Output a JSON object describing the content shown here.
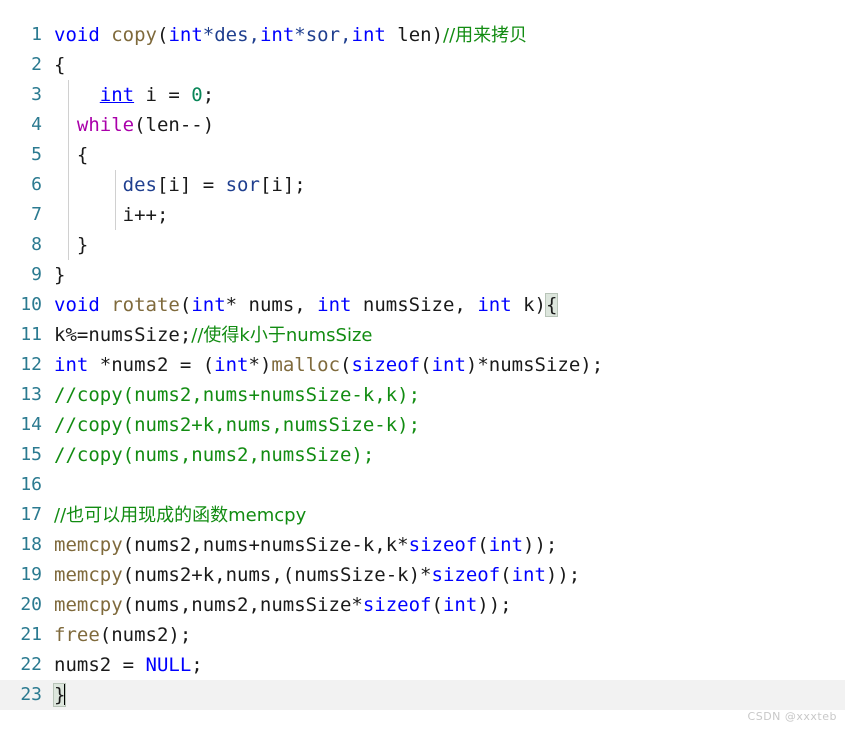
{
  "editor": {
    "language": "C",
    "total_lines": 23,
    "current_line": 23,
    "colors": {
      "background": "#ffffff",
      "line_number": "#2b7a90",
      "keyword": "#0000ff",
      "control_keyword": "#aa00aa",
      "function": "#7f6a3c",
      "parameter": "#1f3f8f",
      "number": "#098658",
      "comment": "#128c12",
      "plain_text": "#1a1a1a",
      "brace_highlight": "#dde6dd",
      "current_line_highlight": "#f2f2f2",
      "indent_guide": "#d0d0d0"
    }
  },
  "lines": [
    {
      "n": "1",
      "tokens": [
        {
          "t": "void",
          "c": "kw"
        },
        {
          "t": " ",
          "c": "plain"
        },
        {
          "t": "copy",
          "c": "fn"
        },
        {
          "t": "(",
          "c": "plain"
        },
        {
          "t": "int",
          "c": "kw"
        },
        {
          "t": "*des,",
          "c": "param"
        },
        {
          "t": "int",
          "c": "kw"
        },
        {
          "t": "*sor,",
          "c": "param"
        },
        {
          "t": "int",
          "c": "kw"
        },
        {
          "t": " len)",
          "c": "plain"
        },
        {
          "t": "//用来拷贝",
          "c": "cmt cjk"
        }
      ]
    },
    {
      "n": "2",
      "tokens": [
        {
          "t": "{",
          "c": "plain"
        }
      ]
    },
    {
      "n": "3",
      "tokens": [
        {
          "t": "    ",
          "c": "plain"
        },
        {
          "t": "int",
          "c": "kw-u"
        },
        {
          "t": " i = ",
          "c": "plain"
        },
        {
          "t": "0",
          "c": "num"
        },
        {
          "t": ";",
          "c": "plain"
        }
      ]
    },
    {
      "n": "4",
      "tokens": [
        {
          "t": "  ",
          "c": "plain"
        },
        {
          "t": "while",
          "c": "ctl"
        },
        {
          "t": "(len--)",
          "c": "plain"
        }
      ]
    },
    {
      "n": "5",
      "tokens": [
        {
          "t": "  {",
          "c": "plain"
        }
      ]
    },
    {
      "n": "6",
      "tokens": [
        {
          "t": "      ",
          "c": "plain"
        },
        {
          "t": "des",
          "c": "param"
        },
        {
          "t": "[i] = ",
          "c": "plain"
        },
        {
          "t": "sor",
          "c": "param"
        },
        {
          "t": "[i];",
          "c": "plain"
        }
      ]
    },
    {
      "n": "7",
      "tokens": [
        {
          "t": "      i++;",
          "c": "plain"
        }
      ]
    },
    {
      "n": "8",
      "tokens": [
        {
          "t": "  }",
          "c": "plain"
        }
      ]
    },
    {
      "n": "9",
      "tokens": [
        {
          "t": "}",
          "c": "plain"
        }
      ]
    },
    {
      "n": "10",
      "tokens": [
        {
          "t": "void",
          "c": "kw"
        },
        {
          "t": " ",
          "c": "plain"
        },
        {
          "t": "rotate",
          "c": "fn"
        },
        {
          "t": "(",
          "c": "plain"
        },
        {
          "t": "int",
          "c": "kw"
        },
        {
          "t": "* nums, ",
          "c": "plain"
        },
        {
          "t": "int",
          "c": "kw"
        },
        {
          "t": " numsSize, ",
          "c": "plain"
        },
        {
          "t": "int",
          "c": "kw"
        },
        {
          "t": " k)",
          "c": "plain"
        },
        {
          "t": "{",
          "c": "brace-hl"
        }
      ]
    },
    {
      "n": "11",
      "tokens": [
        {
          "t": "k%=numsSize;",
          "c": "plain"
        },
        {
          "t": "//使得k小于numsSize",
          "c": "cmt cjk"
        }
      ]
    },
    {
      "n": "12",
      "tokens": [
        {
          "t": "int",
          "c": "kw"
        },
        {
          "t": " *nums2 = (",
          "c": "plain"
        },
        {
          "t": "int",
          "c": "kw"
        },
        {
          "t": "*)",
          "c": "plain"
        },
        {
          "t": "malloc",
          "c": "fn"
        },
        {
          "t": "(",
          "c": "plain"
        },
        {
          "t": "sizeof",
          "c": "kw"
        },
        {
          "t": "(",
          "c": "plain"
        },
        {
          "t": "int",
          "c": "kw"
        },
        {
          "t": ")*numsSize);",
          "c": "plain"
        }
      ]
    },
    {
      "n": "13",
      "tokens": [
        {
          "t": "//copy(nums2,nums+numsSize-k,k);",
          "c": "cmt"
        }
      ]
    },
    {
      "n": "14",
      "tokens": [
        {
          "t": "//copy(nums2+k,nums,numsSize-k);",
          "c": "cmt"
        }
      ]
    },
    {
      "n": "15",
      "tokens": [
        {
          "t": "//copy(nums,nums2,numsSize);",
          "c": "cmt"
        }
      ]
    },
    {
      "n": "16",
      "tokens": [
        {
          "t": "",
          "c": "plain"
        }
      ]
    },
    {
      "n": "17",
      "tokens": [
        {
          "t": "//也可以用现成的函数memcpy",
          "c": "cmt cjk"
        }
      ]
    },
    {
      "n": "18",
      "tokens": [
        {
          "t": "memcpy",
          "c": "fn"
        },
        {
          "t": "(nums2,nums+numsSize-k,k*",
          "c": "plain"
        },
        {
          "t": "sizeof",
          "c": "kw"
        },
        {
          "t": "(",
          "c": "plain"
        },
        {
          "t": "int",
          "c": "kw"
        },
        {
          "t": "));",
          "c": "plain"
        }
      ]
    },
    {
      "n": "19",
      "tokens": [
        {
          "t": "memcpy",
          "c": "fn"
        },
        {
          "t": "(nums2+k,nums,(numsSize-k)*",
          "c": "plain"
        },
        {
          "t": "sizeof",
          "c": "kw"
        },
        {
          "t": "(",
          "c": "plain"
        },
        {
          "t": "int",
          "c": "kw"
        },
        {
          "t": "));",
          "c": "plain"
        }
      ]
    },
    {
      "n": "20",
      "tokens": [
        {
          "t": "memcpy",
          "c": "fn"
        },
        {
          "t": "(nums,nums2,numsSize*",
          "c": "plain"
        },
        {
          "t": "sizeof",
          "c": "kw"
        },
        {
          "t": "(",
          "c": "plain"
        },
        {
          "t": "int",
          "c": "kw"
        },
        {
          "t": "));",
          "c": "plain"
        }
      ]
    },
    {
      "n": "21",
      "tokens": [
        {
          "t": "free",
          "c": "fn"
        },
        {
          "t": "(nums2);",
          "c": "plain"
        }
      ]
    },
    {
      "n": "22",
      "tokens": [
        {
          "t": "nums2 = ",
          "c": "plain"
        },
        {
          "t": "NULL",
          "c": "kw"
        },
        {
          "t": ";",
          "c": "plain"
        }
      ]
    },
    {
      "n": "23",
      "tokens": [
        {
          "t": "}",
          "c": "brace-hl"
        },
        {
          "t": "__CARET__",
          "c": "caret"
        }
      ],
      "current": true
    }
  ],
  "indent_guides": [
    {
      "level": 1,
      "from_line": 3,
      "to_line": 8
    },
    {
      "level": 2,
      "from_line": 6,
      "to_line": 7
    }
  ],
  "watermark": {
    "text": "CSDN @xxxteb"
  }
}
